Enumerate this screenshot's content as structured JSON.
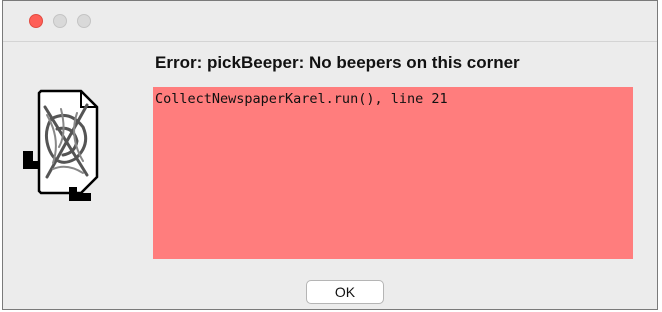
{
  "window": {
    "controls": {
      "close": "close-control",
      "minimize": "minimize-control",
      "zoom": "zoom-control"
    }
  },
  "dialog": {
    "icon": "karel-robot-icon",
    "message": "Error: pickBeeper: No beepers on this corner",
    "trace_lines": [
      "CollectNewspaperKarel.run(), line 21"
    ],
    "ok_label": "OK"
  },
  "colors": {
    "trace_background": "#ff7d7d",
    "close_button": "#fe5f57",
    "window_background": "#ececec"
  }
}
